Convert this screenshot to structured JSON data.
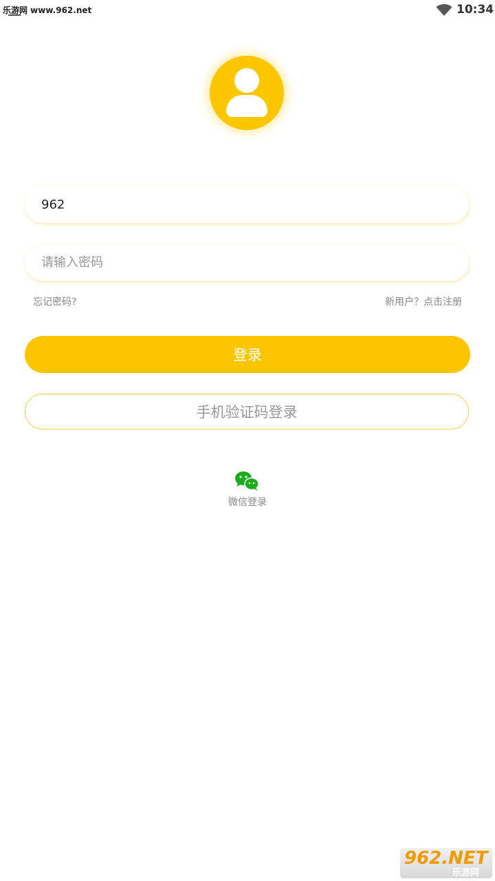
{
  "status_bar": {
    "watermark_text": "乐游网 www.962.net",
    "time": "10:34",
    "wifi_icon": "wifi-icon"
  },
  "avatar": {
    "icon": "user-avatar-icon",
    "color": "#FDC700"
  },
  "login_form": {
    "username_value": "962",
    "password_placeholder": "请输入密码",
    "forgot_password": "忘记密码?",
    "register_link": "新用户？点击注册",
    "login_button": "登录",
    "sms_login_button": "手机验证码登录"
  },
  "social": {
    "wechat_icon": "wechat-icon",
    "wechat_label": "微信登录",
    "wechat_color": "#1AAD19"
  },
  "watermark_badge": {
    "main": "962.NET",
    "sub": "乐游网"
  },
  "colors": {
    "accent": "#FDC500",
    "text_muted": "#888888",
    "border_accent": "#F5D23A"
  }
}
